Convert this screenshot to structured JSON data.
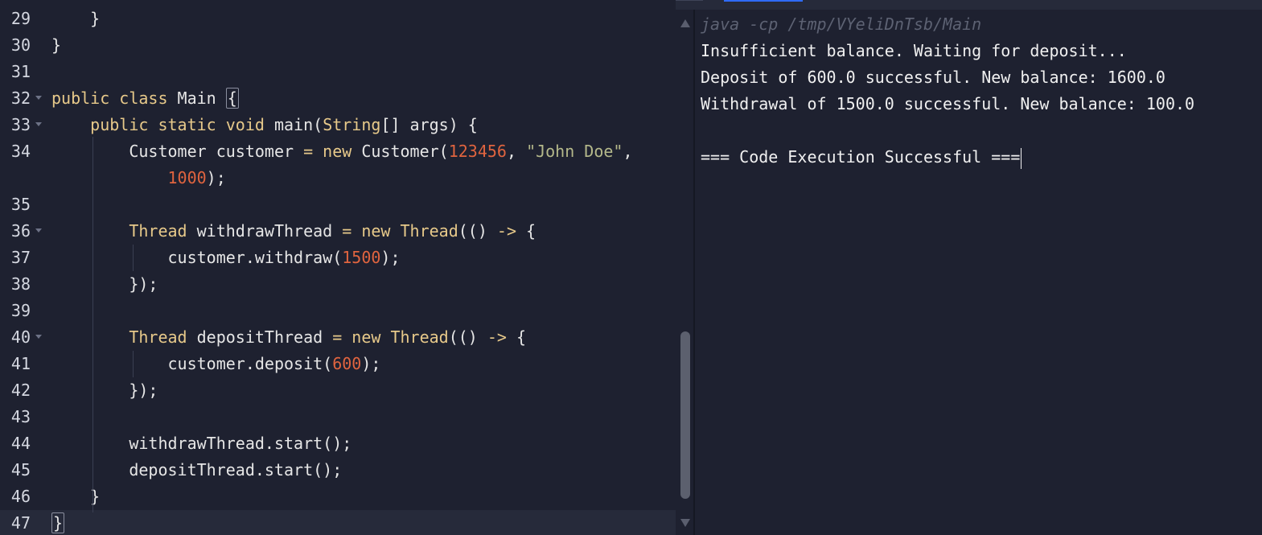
{
  "editor": {
    "lines": [
      {
        "num": "29",
        "fold": false,
        "tokens": [
          {
            "t": "    }",
            "c": ""
          }
        ]
      },
      {
        "num": "30",
        "fold": false,
        "tokens": [
          {
            "t": "}",
            "c": ""
          }
        ]
      },
      {
        "num": "31",
        "fold": false,
        "tokens": []
      },
      {
        "num": "32",
        "fold": true,
        "tokens": [
          {
            "t": "public",
            "c": "kw"
          },
          {
            "t": " ",
            "c": ""
          },
          {
            "t": "class",
            "c": "kw"
          },
          {
            "t": " Main ",
            "c": ""
          },
          {
            "t": "{",
            "c": "brk"
          }
        ]
      },
      {
        "num": "33",
        "fold": true,
        "tokens": [
          {
            "t": "    ",
            "c": ""
          },
          {
            "t": "public",
            "c": "kw"
          },
          {
            "t": " ",
            "c": ""
          },
          {
            "t": "static",
            "c": "kw"
          },
          {
            "t": " ",
            "c": ""
          },
          {
            "t": "void",
            "c": "kw"
          },
          {
            "t": " main(",
            "c": ""
          },
          {
            "t": "String",
            "c": "ty"
          },
          {
            "t": "[] args) {",
            "c": ""
          }
        ]
      },
      {
        "num": "34",
        "fold": false,
        "tokens": [
          {
            "t": "        Customer customer ",
            "c": ""
          },
          {
            "t": "=",
            "c": "op"
          },
          {
            "t": " ",
            "c": ""
          },
          {
            "t": "new",
            "c": "kw"
          },
          {
            "t": " Customer(",
            "c": ""
          },
          {
            "t": "123456",
            "c": "num"
          },
          {
            "t": ", ",
            "c": ""
          },
          {
            "t": "\"John Doe\"",
            "c": "str"
          },
          {
            "t": ",",
            "c": ""
          }
        ]
      },
      {
        "num": "",
        "fold": false,
        "tokens": [
          {
            "t": "            ",
            "c": ""
          },
          {
            "t": "1000",
            "c": "num"
          },
          {
            "t": ");",
            "c": ""
          }
        ]
      },
      {
        "num": "35",
        "fold": false,
        "tokens": []
      },
      {
        "num": "36",
        "fold": true,
        "tokens": [
          {
            "t": "        ",
            "c": ""
          },
          {
            "t": "Thread",
            "c": "ty"
          },
          {
            "t": " withdrawThread ",
            "c": ""
          },
          {
            "t": "=",
            "c": "op"
          },
          {
            "t": " ",
            "c": ""
          },
          {
            "t": "new",
            "c": "kw"
          },
          {
            "t": " ",
            "c": ""
          },
          {
            "t": "Thread",
            "c": "ty"
          },
          {
            "t": "(() ",
            "c": ""
          },
          {
            "t": "->",
            "c": "op"
          },
          {
            "t": " {",
            "c": ""
          }
        ]
      },
      {
        "num": "37",
        "fold": false,
        "tokens": [
          {
            "t": "            customer.withdraw(",
            "c": ""
          },
          {
            "t": "1500",
            "c": "num"
          },
          {
            "t": ");",
            "c": ""
          }
        ]
      },
      {
        "num": "38",
        "fold": false,
        "tokens": [
          {
            "t": "        });",
            "c": ""
          }
        ]
      },
      {
        "num": "39",
        "fold": false,
        "tokens": []
      },
      {
        "num": "40",
        "fold": true,
        "tokens": [
          {
            "t": "        ",
            "c": ""
          },
          {
            "t": "Thread",
            "c": "ty"
          },
          {
            "t": " depositThread ",
            "c": ""
          },
          {
            "t": "=",
            "c": "op"
          },
          {
            "t": " ",
            "c": ""
          },
          {
            "t": "new",
            "c": "kw"
          },
          {
            "t": " ",
            "c": ""
          },
          {
            "t": "Thread",
            "c": "ty"
          },
          {
            "t": "(() ",
            "c": ""
          },
          {
            "t": "->",
            "c": "op"
          },
          {
            "t": " {",
            "c": ""
          }
        ]
      },
      {
        "num": "41",
        "fold": false,
        "tokens": [
          {
            "t": "            customer.deposit(",
            "c": ""
          },
          {
            "t": "600",
            "c": "num"
          },
          {
            "t": ");",
            "c": ""
          }
        ]
      },
      {
        "num": "42",
        "fold": false,
        "tokens": [
          {
            "t": "        });",
            "c": ""
          }
        ]
      },
      {
        "num": "43",
        "fold": false,
        "tokens": []
      },
      {
        "num": "44",
        "fold": false,
        "tokens": [
          {
            "t": "        withdrawThread.start();",
            "c": ""
          }
        ]
      },
      {
        "num": "45",
        "fold": false,
        "tokens": [
          {
            "t": "        depositThread.start();",
            "c": ""
          }
        ]
      },
      {
        "num": "46",
        "fold": false,
        "tokens": [
          {
            "t": "    }",
            "c": ""
          }
        ]
      },
      {
        "num": "47",
        "fold": false,
        "tokens": [
          {
            "t": "}",
            "c": "brk"
          }
        ]
      }
    ]
  },
  "output": {
    "command": "java -cp /tmp/VYeliDnTsb/Main",
    "lines": [
      "Insufficient balance. Waiting for deposit...",
      "Deposit of 600.0 successful. New balance: 1600.0",
      "Withdrawal of 1500.0 successful. New balance: 100.0",
      "",
      "=== Code Execution Successful ==="
    ]
  },
  "colors": {
    "background": "#1e2130",
    "keyword": "#e7c98a",
    "number": "#e0643f",
    "string": "#b4b88a",
    "command": "#5d6273"
  }
}
